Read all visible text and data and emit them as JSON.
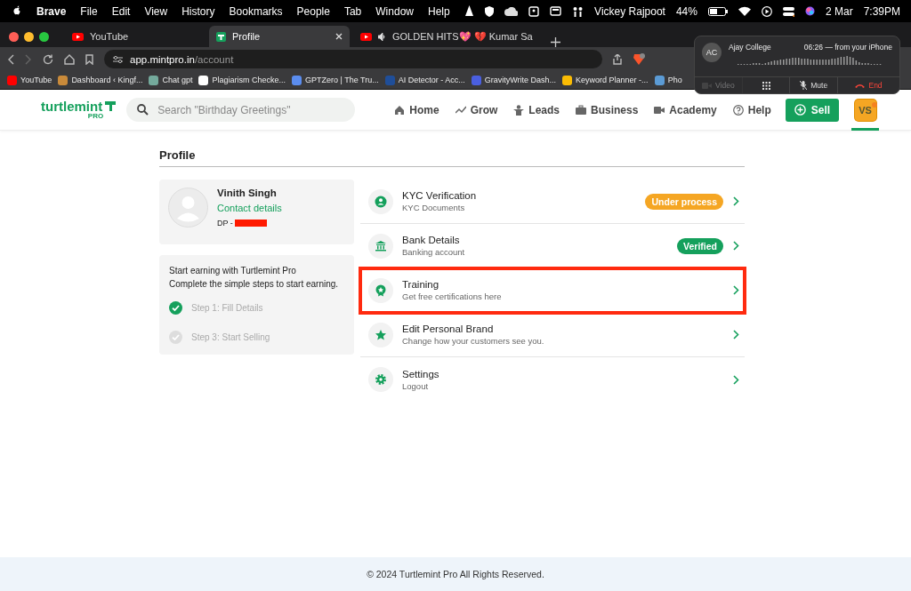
{
  "menu_bar": {
    "app": "Brave",
    "menus": [
      "File",
      "Edit",
      "View",
      "History",
      "Bookmarks",
      "People",
      "Tab",
      "Window",
      "Help"
    ],
    "user": "Vickey Rajpoot",
    "battery": "44%",
    "date": "2 Mar",
    "time": "7:39PM"
  },
  "browser": {
    "tabs": [
      {
        "label": "YouTube",
        "selected": false,
        "kind": "video"
      },
      {
        "label": "Profile",
        "selected": true,
        "kind": "site"
      },
      {
        "label": "GOLDEN HITS💖 💔 Kumar Sa",
        "selected": false,
        "kind": "video"
      }
    ],
    "address": {
      "host": "app.mintpro.in",
      "path": "/account"
    },
    "bookmarks": [
      {
        "label": "YouTube",
        "color": "#ff0000"
      },
      {
        "label": "Dashboard ‹ Kingf...",
        "color": "#c98a3a"
      },
      {
        "label": "Chat gpt",
        "color": "#74aa9c"
      },
      {
        "label": "Plagiarism Checke...",
        "color": "#ffffff"
      },
      {
        "label": "GPTZero | The Tru...",
        "color": "#5b8def"
      },
      {
        "label": "AI Detector - Acc...",
        "color": "#1f4e99"
      },
      {
        "label": "GravityWrite Dash...",
        "color": "#4a5fe0"
      },
      {
        "label": "Keyword Planner -...",
        "color": "#fbbc04"
      },
      {
        "label": "Pho",
        "color": "#5b9bd5"
      }
    ]
  },
  "call": {
    "initials": "AC",
    "caller": "Ajay College",
    "info": "06:26 — from your iPhone",
    "actions": [
      {
        "label": "Video",
        "kind": "video",
        "disabled": true
      },
      {
        "kind": "keypad",
        "disabled": false
      },
      {
        "label": "Mute",
        "kind": "mute",
        "disabled": false
      },
      {
        "label": "End",
        "kind": "end",
        "disabled": false
      }
    ]
  },
  "header": {
    "logo": "turtlemint",
    "logo_sub": "PRO",
    "search": {
      "placeholder": "Search \"Birthday Greetings\""
    },
    "nav": [
      {
        "label": "Home",
        "kind": "home"
      },
      {
        "label": "Grow",
        "kind": "grow"
      },
      {
        "label": "Leads",
        "kind": "leads"
      },
      {
        "label": "Business",
        "kind": "business"
      },
      {
        "label": "Academy",
        "kind": "academy"
      },
      {
        "label": "Help",
        "kind": "help"
      }
    ],
    "sell": "Sell",
    "avatar": {
      "initials": "VS",
      "selected": true
    }
  },
  "page": {
    "title": "Profile",
    "user": {
      "name": "Vinith Singh",
      "contact": "Contact details",
      "dp": "DP -"
    },
    "earning": {
      "lines": [
        "Start earning with Turtlemint Pro",
        "Complete the simple steps to start earning."
      ],
      "steps": [
        {
          "label": "Step 1: Fill Details",
          "checked": true
        },
        {
          "label": "Step 3: Start Selling",
          "checked": false
        }
      ]
    },
    "items": [
      {
        "title": "KYC Verification",
        "subtitle": "KYC Documents",
        "kind": "person",
        "badge": {
          "label": "Under process",
          "kind": "pending"
        },
        "highlighted": false
      },
      {
        "title": "Bank Details",
        "subtitle": "Banking account",
        "kind": "bank",
        "badge": {
          "label": "Verified",
          "kind": "verified"
        },
        "highlighted": false
      },
      {
        "title": "Training",
        "subtitle": "Get free certifications here",
        "kind": "award",
        "highlighted": true
      },
      {
        "title": "Edit Personal Brand",
        "subtitle": "Change how your customers see you.",
        "kind": "star",
        "highlighted": false
      },
      {
        "title": "Settings",
        "subtitle": "Logout",
        "kind": "gear",
        "highlighted": false
      }
    ]
  },
  "footer": "© 2024 Turtlemint Pro All Rights Reserved."
}
